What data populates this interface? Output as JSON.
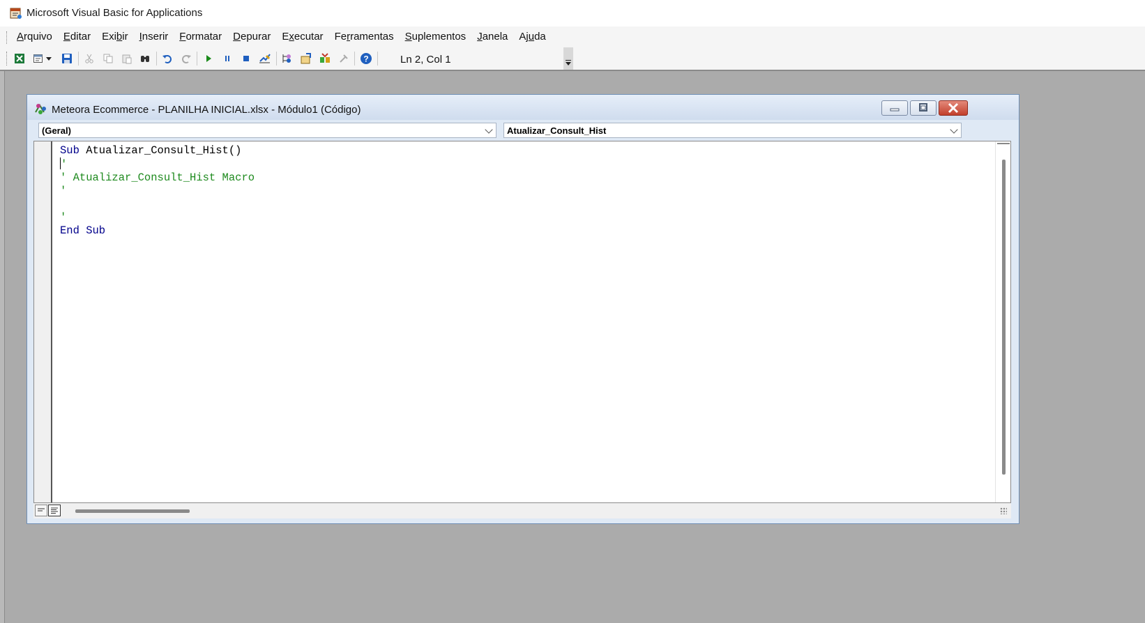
{
  "app": {
    "title": "Microsoft Visual Basic for Applications",
    "icon": "vba-app-icon"
  },
  "menu": [
    {
      "accel": "A",
      "rest": "rquivo"
    },
    {
      "accel": "E",
      "rest": "ditar"
    },
    {
      "pre": "Exi",
      "accel": "b",
      "rest": "ir"
    },
    {
      "accel": "I",
      "rest": "nserir"
    },
    {
      "accel": "F",
      "rest": "ormatar"
    },
    {
      "accel": "D",
      "rest": "epurar"
    },
    {
      "pre": "E",
      "accel": "x",
      "rest": "ecutar"
    },
    {
      "pre": "Fe",
      "accel": "r",
      "rest": "ramentas"
    },
    {
      "accel": "S",
      "rest": "uplementos"
    },
    {
      "accel": "J",
      "rest": "anela"
    },
    {
      "pre": "Aj",
      "accel": "u",
      "rest": "da"
    }
  ],
  "toolbar": {
    "cursor_position": "Ln 2, Col 1",
    "icons": [
      "excel-icon",
      "insert-module-icon",
      "save-icon",
      "cut-icon",
      "copy-icon",
      "paste-icon",
      "find-icon",
      "undo-icon",
      "redo-icon",
      "run-icon",
      "break-icon",
      "reset-icon",
      "design-mode-icon",
      "project-explorer-icon",
      "properties-icon",
      "object-browser-icon",
      "toolbox-icon",
      "help-icon"
    ]
  },
  "code_window": {
    "title": "Meteora Ecommerce - PLANILHA INICIAL.xlsx - Módulo1 (Código)",
    "object_combo": "(Geral)",
    "procedure_combo": "Atualizar_Consult_Hist",
    "code": {
      "line1_kw": "Sub",
      "line1_name": " Atualizar_Consult_Hist()",
      "line2": "'",
      "line3": "' Atualizar_Consult_Hist Macro",
      "line4": "'",
      "line5": "",
      "line6": "'",
      "line7": "End Sub"
    }
  },
  "colors": {
    "keyword": "#00008b",
    "comment": "#1e8a1e",
    "workspace": "#ababab"
  }
}
